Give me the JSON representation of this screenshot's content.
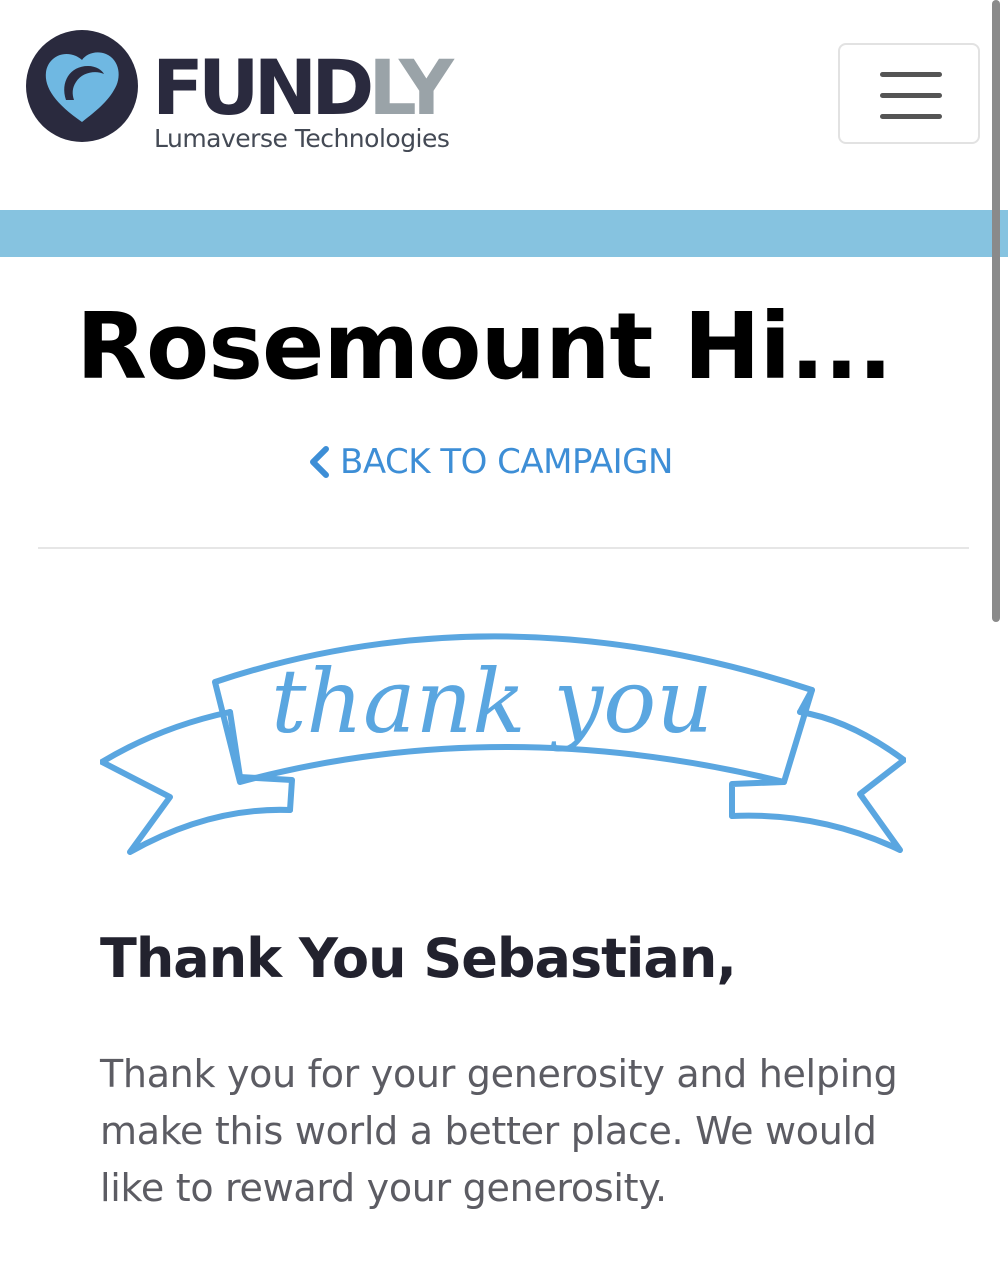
{
  "header": {
    "brand_primary": "FUND",
    "brand_secondary": "LY",
    "tagline": "Lumaverse Technologies",
    "logo_icon": "heart-icon",
    "menu_icon": "hamburger-menu-icon"
  },
  "colors": {
    "brand_dark": "#2a2a3e",
    "brand_gray": "#9aa3a8",
    "accent_band": "#86c3e0",
    "link_blue": "#3d8ed6",
    "banner_blue": "#5aa6e0"
  },
  "campaign": {
    "title": "Rosemount Hi...",
    "back_label": "BACK TO CAMPAIGN",
    "back_icon": "chevron-left-icon"
  },
  "banner": {
    "text": "thank you"
  },
  "thank_you": {
    "greeting": "Thank You Sebastian,",
    "message": "Thank you for your generosity and helping make this world a better place. We would like to reward your generosity."
  }
}
